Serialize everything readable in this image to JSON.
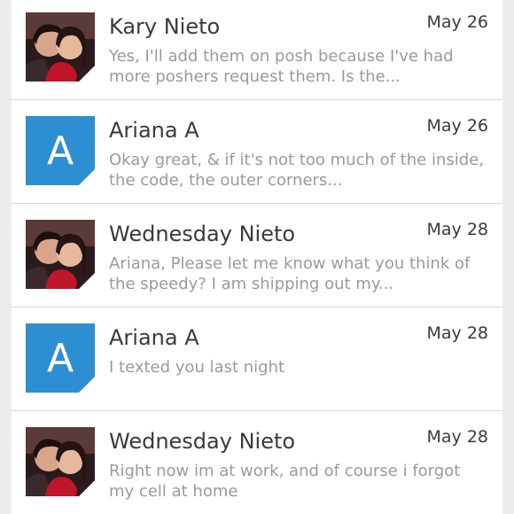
{
  "conversations": [
    {
      "name": "Kary Nieto",
      "date": "May 26",
      "preview": "Yes, I'll add them on posh because I've had more poshers request them. Is the...",
      "avatar": {
        "type": "photo",
        "icon": "couple-photo"
      }
    },
    {
      "name": "Ariana A",
      "date": "May 26",
      "preview": "Okay great, & if it's not too much of the inside, the code, the outer corners...",
      "avatar": {
        "type": "letter",
        "letter": "A",
        "color": "#2d8fd1"
      }
    },
    {
      "name": "Wednesday Nieto",
      "date": "May 28",
      "preview": "Ariana, Please let me know what you think of the speedy? I am shipping out my...",
      "avatar": {
        "type": "photo",
        "icon": "couple-photo"
      }
    },
    {
      "name": "Ariana A",
      "date": "May 28",
      "preview": "I texted you last night",
      "avatar": {
        "type": "letter",
        "letter": "A",
        "color": "#2d8fd1"
      }
    },
    {
      "name": "Wednesday Nieto",
      "date": "May 28",
      "preview": "Right now im at work, and of course i forgot my cell at home",
      "avatar": {
        "type": "photo",
        "icon": "couple-photo"
      }
    }
  ]
}
